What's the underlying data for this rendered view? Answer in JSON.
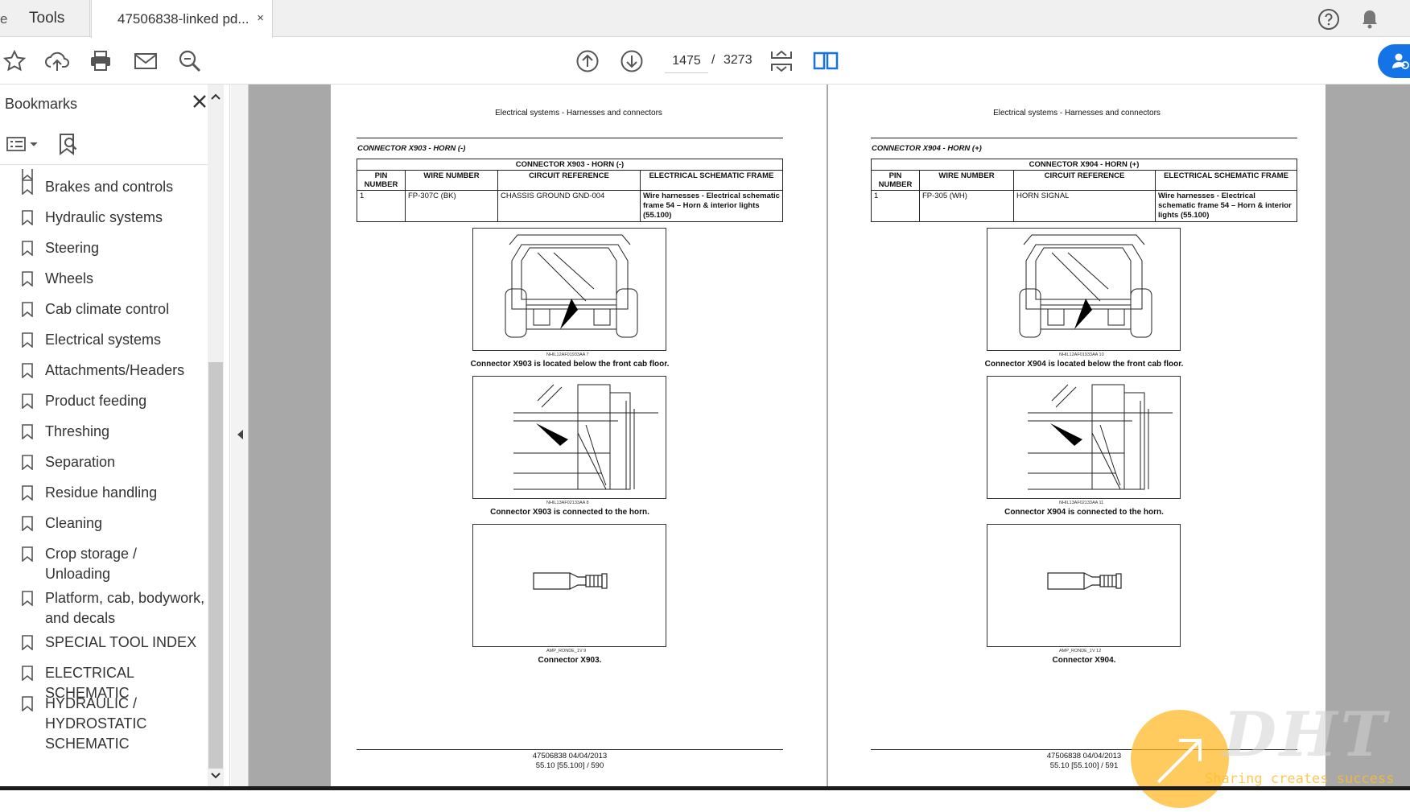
{
  "tabs": {
    "tools_label": "Tools",
    "doc_label": "47506838-linked pd...",
    "close_symbol": "×"
  },
  "toolbar": {
    "current_page": "1475",
    "page_separator": "/",
    "total_pages": "3273"
  },
  "sidebar": {
    "title": "Bookmarks",
    "items": [
      {
        "label": "Brakes and controls"
      },
      {
        "label": "Hydraulic systems"
      },
      {
        "label": "Steering"
      },
      {
        "label": "Wheels"
      },
      {
        "label": "Cab climate control"
      },
      {
        "label": "Electrical systems"
      },
      {
        "label": "Attachments/Headers"
      },
      {
        "label": "Product feeding"
      },
      {
        "label": "Threshing"
      },
      {
        "label": "Separation"
      },
      {
        "label": "Residue handling"
      },
      {
        "label": "Cleaning"
      },
      {
        "label": "Crop storage / Unloading"
      },
      {
        "label": "Platform, cab, bodywork, and decals"
      },
      {
        "label": "SPECIAL TOOL INDEX"
      },
      {
        "label": "ELECTRICAL SCHEMATIC"
      },
      {
        "label": "HYDRAULIC / HYDROSTATIC SCHEMATIC"
      }
    ]
  },
  "pages": [
    {
      "header": "Electrical systems - Harnesses and connectors",
      "connector_title": "CONNECTOR X903 - HORN (-)",
      "table_title": "CONNECTOR X903 - HORN (-)",
      "columns": [
        "PIN NUMBER",
        "WIRE NUMBER",
        "CIRCUIT REFERENCE",
        "ELECTRICAL SCHEMATIC FRAME"
      ],
      "row": [
        "1",
        "FP-307C (BK)",
        "CHASSIS GROUND GND-004",
        "Wire harnesses - Electrical schematic frame 54 – Horn & interior lights (55.100)"
      ],
      "fig1_code": "NHIL12AF01933AA 7",
      "fig1_caption": "Connector X903 is located below the front cab floor.",
      "fig2_code": "NHIL13AF02133AA 8",
      "fig2_caption": "Connector X903 is connected to the horn.",
      "fig3_code": "AMP_RONDE_1V 9",
      "fig3_caption": "Connector X903.",
      "footer_line1": "47506838 04/04/2013",
      "footer_line2": "55.10 [55.100] / 590"
    },
    {
      "header": "Electrical systems - Harnesses and connectors",
      "connector_title": "CONNECTOR X904 - HORN (+)",
      "table_title": "CONNECTOR X904 - HORN (+)",
      "columns": [
        "PIN NUMBER",
        "WIRE NUMBER",
        "CIRCUIT REFERENCE",
        "ELECTRICAL SCHEMATIC FRAME"
      ],
      "row": [
        "1",
        "FP-305 (WH)",
        "HORN SIGNAL",
        "Wire harnesses - Electrical schematic frame 54 – Horn & interior lights (55.100)"
      ],
      "fig1_code": "NHIL12AF01933AA 10",
      "fig1_caption": "Connector X904 is located below the front cab floor.",
      "fig2_code": "NHIL13AF02133AA 11",
      "fig2_caption": "Connector X904 is connected to the horn.",
      "fig3_code": "AMP_RONDE_1V 12",
      "fig3_caption": "Connector X904.",
      "footer_line1": "47506838 04/04/2013",
      "footer_line2": "55.10 [55.100] / 591"
    }
  ],
  "watermark": {
    "brand": "DHT",
    "tagline": "Sharing creates success"
  },
  "icons": [
    "star-icon",
    "upload-icon",
    "print-icon",
    "mail-icon",
    "zoom-icon",
    "page-up-icon",
    "page-down-icon",
    "fit-page-icon",
    "two-page-icon",
    "help-icon",
    "bell-icon",
    "share-user-icon",
    "bookmark-list-icon",
    "bookmark-search-icon",
    "bookmark-icon",
    "collapse-left-icon",
    "scroll-up-icon",
    "scroll-down-icon"
  ],
  "colors": {
    "accent": "#1473e6",
    "viewer_bg": "#a8a8a8",
    "watermark_orange": "#ffba28"
  }
}
